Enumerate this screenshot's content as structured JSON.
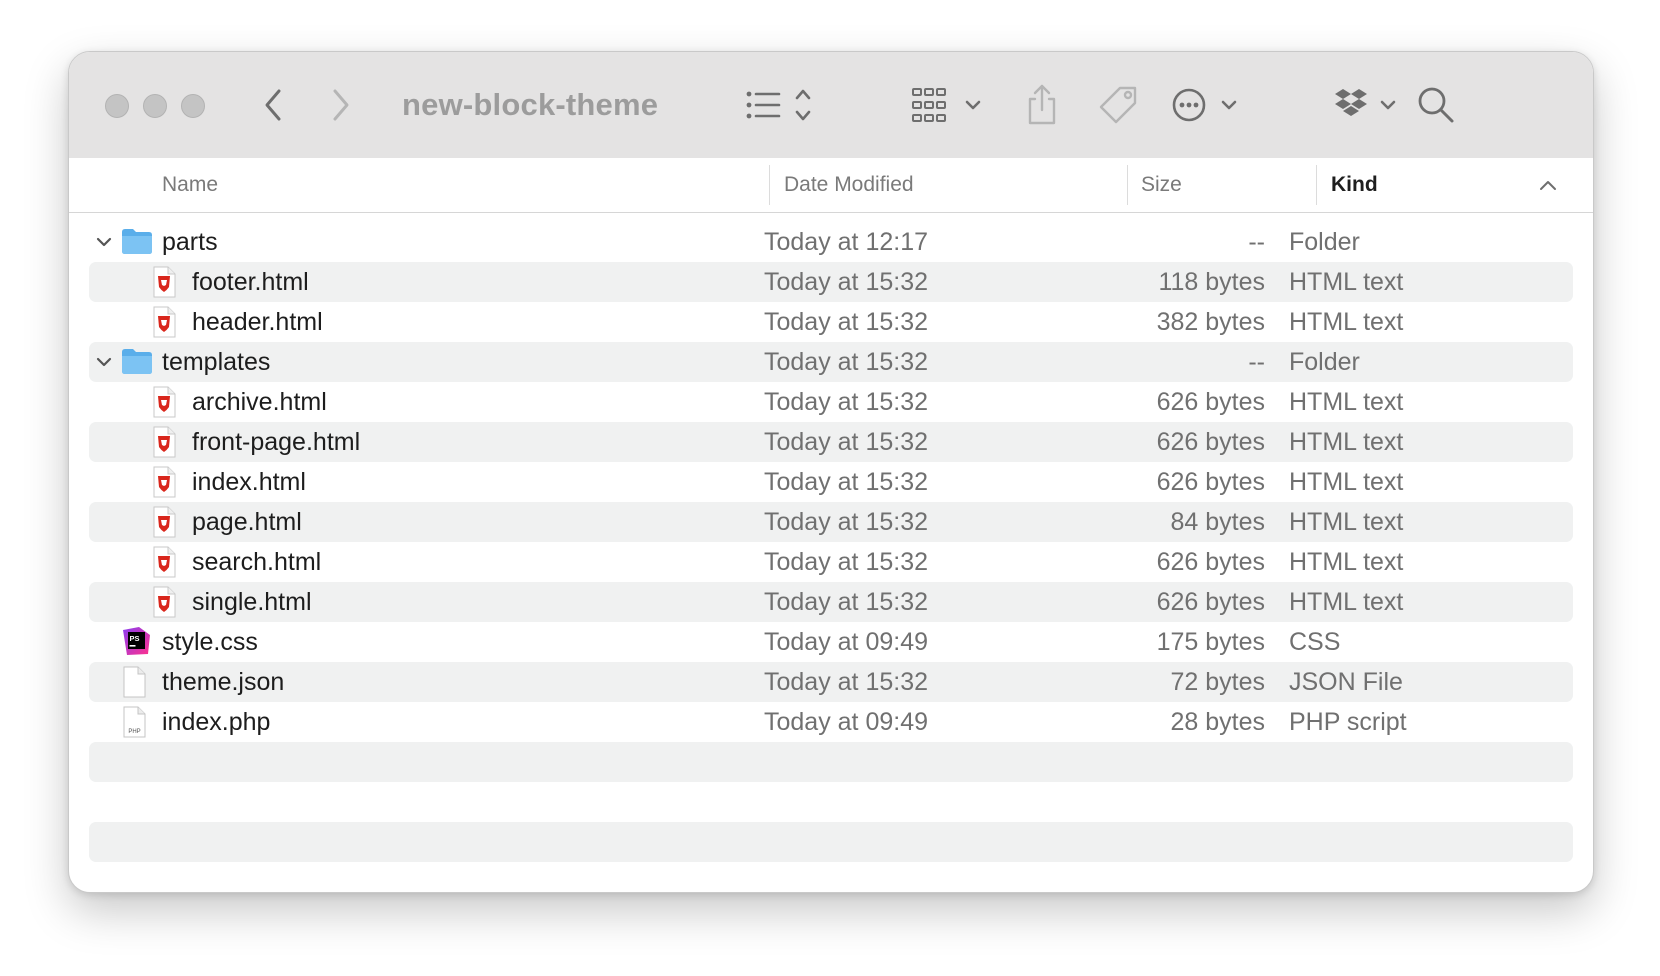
{
  "window": {
    "title": "new-block-theme"
  },
  "toolbar": {
    "back_icon": "chevron-left-icon",
    "forward_icon": "chevron-right-icon",
    "view_icon": "list-view-icon",
    "group_icon": "grid-group-icon",
    "share_icon": "share-icon",
    "tag_icon": "tag-icon",
    "action_icon": "ellipsis-circle-icon",
    "dropbox_icon": "dropbox-icon",
    "search_icon": "search-icon"
  },
  "columns": {
    "name": "Name",
    "date": "Date Modified",
    "size": "Size",
    "kind": "Kind",
    "sorted_by": "Kind",
    "sort_direction": "ascending"
  },
  "files": [
    {
      "name": "parts",
      "date": "Today at 12:17",
      "size": "--",
      "kind": "Folder",
      "icon": "folder-icon",
      "level": 0,
      "expanded": true
    },
    {
      "name": "footer.html",
      "date": "Today at 15:32",
      "size": "118 bytes",
      "kind": "HTML text",
      "icon": "html-file-icon",
      "level": 1
    },
    {
      "name": "header.html",
      "date": "Today at 15:32",
      "size": "382 bytes",
      "kind": "HTML text",
      "icon": "html-file-icon",
      "level": 1
    },
    {
      "name": "templates",
      "date": "Today at 15:32",
      "size": "--",
      "kind": "Folder",
      "icon": "folder-icon",
      "level": 0,
      "expanded": true
    },
    {
      "name": "archive.html",
      "date": "Today at 15:32",
      "size": "626 bytes",
      "kind": "HTML text",
      "icon": "html-file-icon",
      "level": 1
    },
    {
      "name": "front-page.html",
      "date": "Today at 15:32",
      "size": "626 bytes",
      "kind": "HTML text",
      "icon": "html-file-icon",
      "level": 1
    },
    {
      "name": "index.html",
      "date": "Today at 15:32",
      "size": "626 bytes",
      "kind": "HTML text",
      "icon": "html-file-icon",
      "level": 1
    },
    {
      "name": "page.html",
      "date": "Today at 15:32",
      "size": "84 bytes",
      "kind": "HTML text",
      "icon": "html-file-icon",
      "level": 1
    },
    {
      "name": "search.html",
      "date": "Today at 15:32",
      "size": "626 bytes",
      "kind": "HTML text",
      "icon": "html-file-icon",
      "level": 1
    },
    {
      "name": "single.html",
      "date": "Today at 15:32",
      "size": "626 bytes",
      "kind": "HTML text",
      "icon": "html-file-icon",
      "level": 1
    },
    {
      "name": "style.css",
      "date": "Today at 09:49",
      "size": "175 bytes",
      "kind": "CSS",
      "icon": "phpstorm-css-icon",
      "level": 0
    },
    {
      "name": "theme.json",
      "date": "Today at 15:32",
      "size": "72 bytes",
      "kind": "JSON File",
      "icon": "blank-document-icon",
      "level": 0
    },
    {
      "name": "index.php",
      "date": "Today at 09:49",
      "size": "28 bytes",
      "kind": "PHP script",
      "icon": "php-file-icon",
      "level": 0
    }
  ],
  "icon_labels": {
    "ps": "PS",
    "php": "PHP"
  },
  "colors": {
    "toolbar_bg": "#e4e3e3",
    "row_stripe": "#f0f1f1",
    "folder_blue": "#5aaeea",
    "html_red": "#d9261c",
    "phpstorm_pink": "#ff318c",
    "phpstorm_purple": "#8b3cf0"
  }
}
